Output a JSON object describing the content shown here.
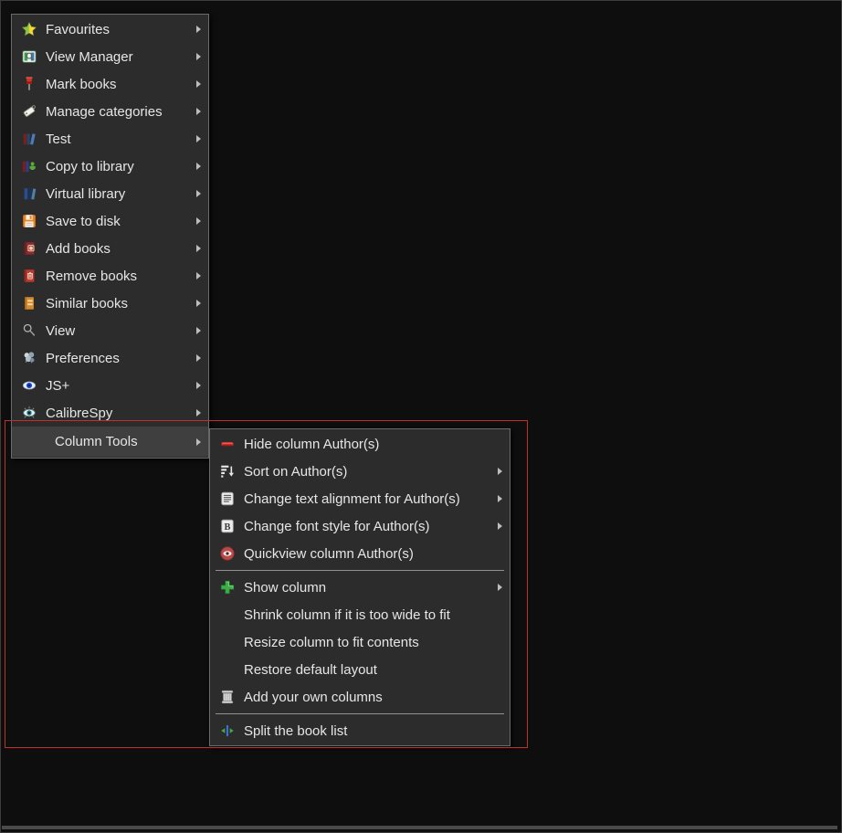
{
  "window": {
    "background": "#0e0e0e",
    "frame_border": "#3c3c3c"
  },
  "colors": {
    "menu_bg": "#2c2c2c",
    "menu_border": "#6b6b6b",
    "selected_bg": "#3f3f3f",
    "text": "#e6e6e6",
    "separator": "#909090",
    "highlight_red": "#c22f2f"
  },
  "main_menu": {
    "items": [
      {
        "label": "Favourites",
        "icon": "favourites-star-icon",
        "has_submenu": true
      },
      {
        "label": "View Manager",
        "icon": "view-manager-icon",
        "has_submenu": true
      },
      {
        "label": "Mark books",
        "icon": "pushpin-icon",
        "has_submenu": true
      },
      {
        "label": "Manage categories",
        "icon": "tag-icon",
        "has_submenu": true
      },
      {
        "label": "Test",
        "icon": "books-row-icon",
        "has_submenu": true
      },
      {
        "label": "Copy to library",
        "icon": "copy-library-icon",
        "has_submenu": true
      },
      {
        "label": "Virtual library",
        "icon": "virtual-library-icon",
        "has_submenu": true
      },
      {
        "label": "Save to disk",
        "icon": "floppy-disk-icon",
        "has_submenu": true
      },
      {
        "label": "Add books",
        "icon": "add-book-icon",
        "has_submenu": true
      },
      {
        "label": "Remove books",
        "icon": "remove-book-icon",
        "has_submenu": true
      },
      {
        "label": "Similar books",
        "icon": "similar-books-icon",
        "has_submenu": true
      },
      {
        "label": "View",
        "icon": "magnifier-icon",
        "has_submenu": true
      },
      {
        "label": "Preferences",
        "icon": "preferences-icon",
        "has_submenu": true
      },
      {
        "label": "JS+",
        "icon": "blue-eye-icon",
        "has_submenu": true
      },
      {
        "label": "CalibreSpy",
        "icon": "spy-eye-icon",
        "has_submenu": true
      },
      {
        "label": "Column Tools",
        "icon": null,
        "has_submenu": true,
        "selected": true
      }
    ]
  },
  "column_tools_submenu": {
    "items": [
      {
        "label": "Hide column Author(s)",
        "icon": "hide-column-icon",
        "has_submenu": false
      },
      {
        "label": "Sort on Author(s)",
        "icon": "sort-icon",
        "has_submenu": true
      },
      {
        "label": "Change text alignment for Author(s)",
        "icon": "text-align-icon",
        "has_submenu": true
      },
      {
        "label": "Change font style for Author(s)",
        "icon": "bold-icon",
        "has_submenu": true
      },
      {
        "label": "Quickview column Author(s)",
        "icon": "quickview-eye-icon",
        "has_submenu": false
      },
      {
        "type": "separator"
      },
      {
        "label": "Show column",
        "icon": "green-plus-icon",
        "has_submenu": true
      },
      {
        "label": "Shrink column if it is too wide to fit",
        "icon": null,
        "has_submenu": false
      },
      {
        "label": "Resize column to fit contents",
        "icon": null,
        "has_submenu": false
      },
      {
        "label": "Restore default layout",
        "icon": null,
        "has_submenu": false
      },
      {
        "label": "Add your own columns",
        "icon": "column-pillar-icon",
        "has_submenu": false
      },
      {
        "type": "separator"
      },
      {
        "label": "Split the book list",
        "icon": "split-icon",
        "has_submenu": false
      }
    ]
  }
}
